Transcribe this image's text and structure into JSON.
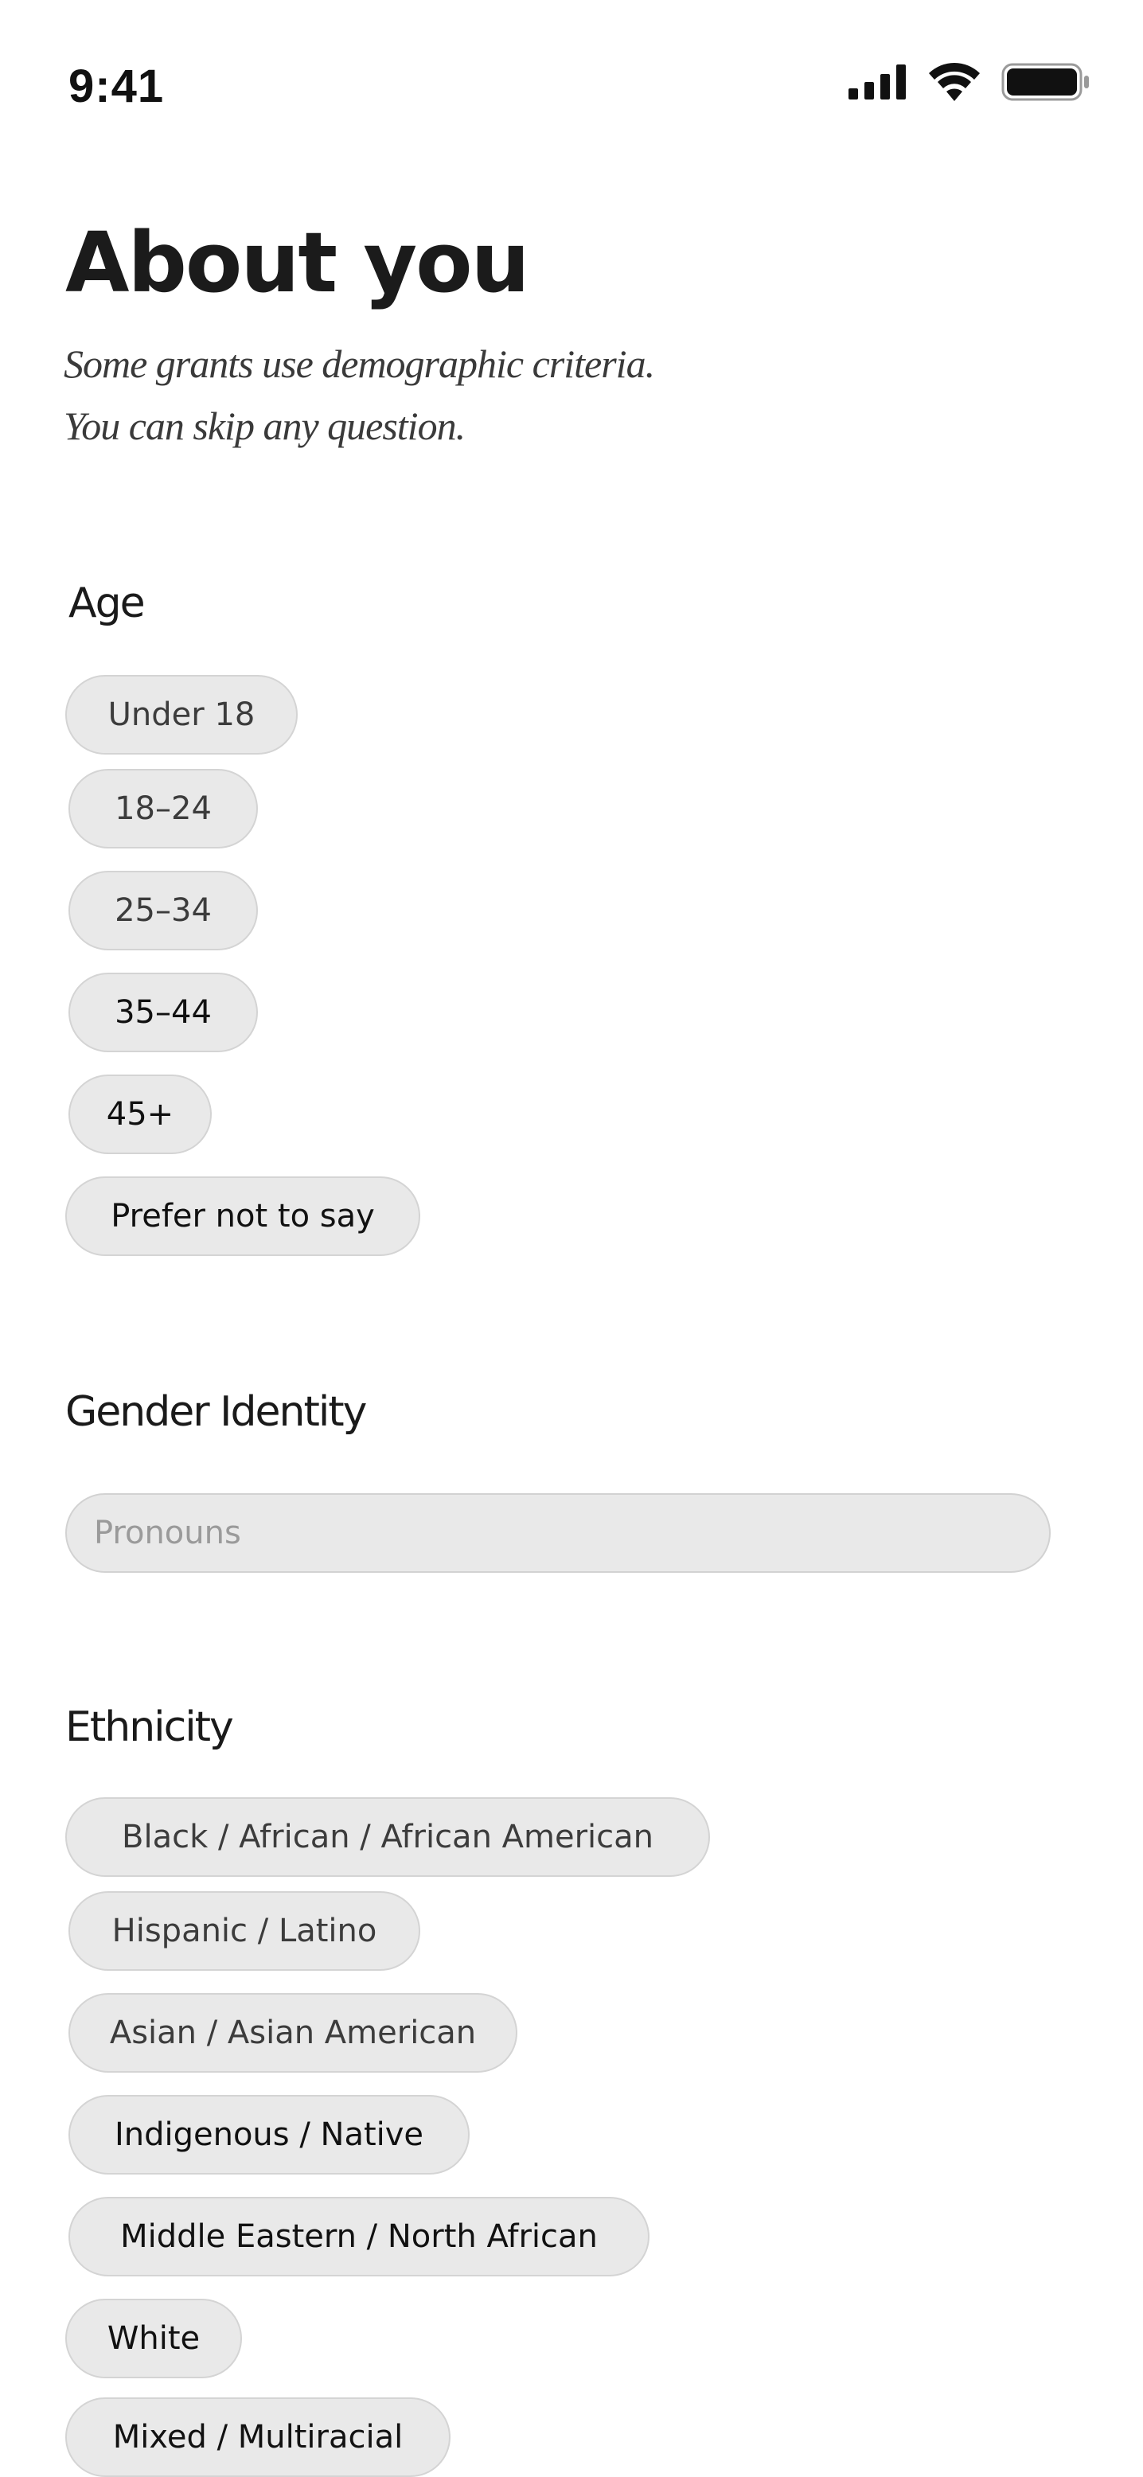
{
  "status_bar": {
    "time": "9:41",
    "icons": [
      "cellular-signal-icon",
      "wifi-icon",
      "battery-icon"
    ]
  },
  "header": {
    "title": "About you",
    "subtitle_line1": "Some grants use demographic criteria.",
    "subtitle_line2": "You can skip any question."
  },
  "age": {
    "heading": "Age",
    "options": [
      "Under 18",
      "18–24",
      "25–34",
      "35–44",
      "45+",
      "Prefer not to say"
    ]
  },
  "gender": {
    "heading": "Gender Identity",
    "pronouns_placeholder": "Pronouns",
    "pronouns_value": ""
  },
  "ethnicity": {
    "heading": "Ethnicity",
    "options": [
      "Black / African / African American",
      "Hispanic / Latino",
      "Asian / Asian American",
      "Indigenous / Native",
      "Middle Eastern / North African",
      "White",
      "Mixed / Multiracial"
    ]
  },
  "colors": {
    "chip_background": "#e9e9e9",
    "chip_border": "#d4d4d4",
    "text_primary": "#1b1b1b"
  }
}
